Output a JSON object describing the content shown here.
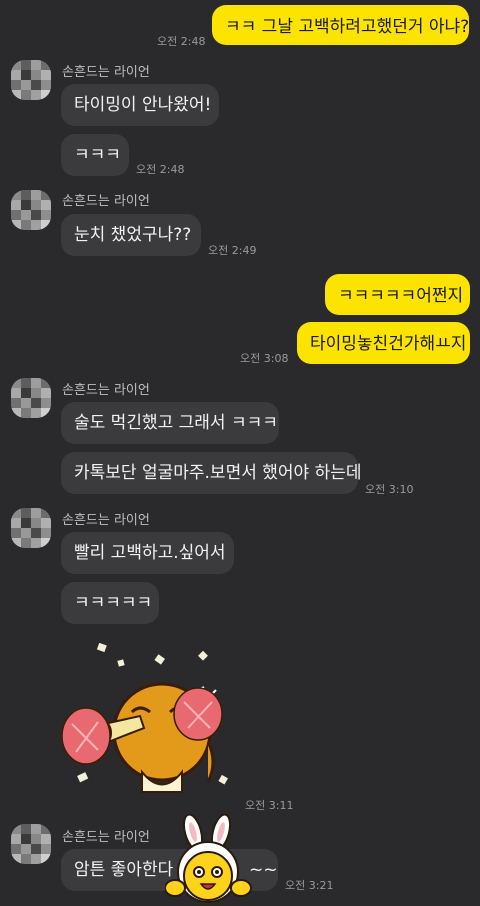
{
  "colors": {
    "background": "#2a2a2c",
    "my_bubble": "#fce300",
    "their_bubble": "#3b3b3e"
  },
  "messages": {
    "m1": {
      "text": "ㅋㅋ 그날 고백하려고했던거 아냐?",
      "time": "오전 2:48"
    },
    "g1": {
      "sender": "손흔드는 라이언",
      "b1": "타이밍이 안나왔어!",
      "b2": "ㅋㅋㅋ",
      "time": "오전 2:48"
    },
    "g2": {
      "sender": "손흔드는 라이언",
      "b1": "눈치 챘었구나??",
      "time": "오전 2:49"
    },
    "m2": {
      "b1": "ㅋㅋㅋㅋㅋ어쩐지",
      "b2": "타이밍놓친건가해ㅛ지",
      "time": "오전 3:08"
    },
    "g3": {
      "sender": "손흔드는 라이언",
      "b1": "술도 먹긴했고 그래서 ㅋㅋㅋ",
      "b2": "카톡보단 얼굴마주.보면서 했어야 하는데",
      "time": "오전 3:10"
    },
    "g4": {
      "sender": "손흔드는 라이언",
      "b1": "빨리 고백하고.싶어서",
      "b2": "ㅋㅋㅋㅋㅋ",
      "time": "오전 3:11"
    },
    "g5": {
      "sender": "손흔드는 라이언",
      "b1": "암튼 좋아한다",
      "b1_tail": "~~",
      "time": "오전 3:21"
    }
  },
  "stickers": {
    "cheer": "ryan-cheering-sticker",
    "peek": "bunny-hat-character-sticker"
  }
}
